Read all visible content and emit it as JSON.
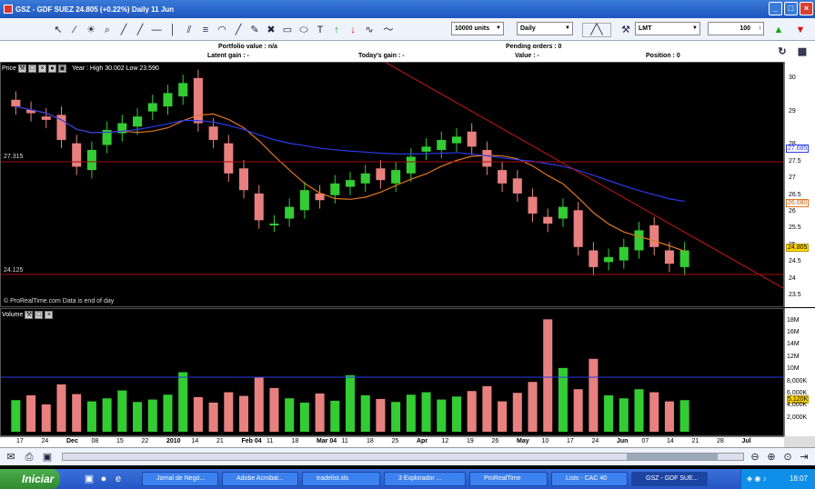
{
  "window": {
    "title": "GSZ - GDF SUEZ    24.805 (+0.22%)    Daily   11 Jun",
    "controls": [
      "_",
      "□",
      "×"
    ]
  },
  "toolbar": {
    "units": "10000 units",
    "interval": "Daily",
    "order_type": "LMT",
    "quantity": "100"
  },
  "info": {
    "portfolio_value": "Portfolio value : n/a",
    "latent_gain": "Latent gain : -",
    "todays_gain": "Today's gain : -",
    "pending_orders": "Pending orders : 0",
    "value": "Value : -",
    "position": "Position : 0"
  },
  "price_panel": {
    "label": "Price",
    "stats": "Year : High 30.002 Low 23.590",
    "copyright": "© ProRealTime.com  Data is end of day",
    "level_high_label": "27.315",
    "level_low_label": "24.125",
    "y_ticks": [
      "30",
      "29",
      "28",
      "27.5",
      "27",
      "26.5",
      "26",
      "25.5",
      "25",
      "24.5",
      "24",
      "23.5"
    ],
    "badges": {
      "ma_blue": "27.685",
      "ma_orange": "26.080",
      "last": "24.805"
    },
    "colors": {
      "up": "#33cc33",
      "down": "#e88080",
      "ma_blue": "#2a3ae8",
      "ma_orange": "#e07820",
      "trend": "#c81818",
      "level": "#a01010"
    }
  },
  "volume_panel": {
    "label": "Volume",
    "y_ticks": [
      "18M",
      "16M",
      "14M",
      "12M",
      "10M",
      "8,000K",
      "6,000K",
      "5,120K",
      "4,000K",
      "2,000K"
    ]
  },
  "x_axis": [
    "17",
    "24",
    "Dec",
    "08",
    "15",
    "22",
    "2010",
    "14",
    "21",
    "Feb 04",
    "11",
    "18",
    "Mar 04",
    "11",
    "18",
    "25",
    "Apr",
    "12",
    "19",
    "26",
    "May",
    "10",
    "17",
    "24",
    "Jun",
    "07",
    "14",
    "21",
    "28",
    "Jul"
  ],
  "taskbar": {
    "start": "Iniciar",
    "items": [
      "Jornal de Negó...",
      "Adobe Acrobat...",
      "tradelist.xls",
      "3 Explorador ...",
      "ProRealTime",
      "Lists - CAC 40",
      "GSZ - GDF SUE..."
    ],
    "clock": "18:07"
  },
  "chart_data": {
    "type": "candlestick",
    "title": "GSZ - GDF SUEZ",
    "series": [
      {
        "name": "Price close (approx.)",
        "values": [
          29.2,
          29.0,
          28.8,
          28.2,
          27.4,
          27.9,
          28.5,
          28.7,
          28.9,
          29.3,
          29.6,
          29.9,
          28.7,
          28.2,
          27.2,
          26.7,
          25.8,
          25.7,
          26.2,
          26.7,
          26.4,
          26.9,
          27.0,
          27.2,
          27.0,
          27.3,
          27.7,
          28.0,
          28.2,
          28.3,
          28.0,
          27.4,
          26.9,
          26.6,
          26.0,
          25.7,
          26.2,
          25.0,
          24.4,
          24.7,
          25.0,
          25.5,
          25.0,
          24.5,
          24.9
        ]
      },
      {
        "name": "Volume (M, approx.)",
        "values": [
          5.2,
          6.0,
          4.5,
          7.8,
          6.2,
          5.0,
          5.5,
          6.8,
          4.9,
          5.3,
          6.1,
          9.8,
          5.7,
          4.8,
          6.5,
          5.9,
          9.0,
          7.2,
          5.5,
          4.8,
          6.3,
          5.1,
          9.3,
          6.0,
          5.4,
          4.9,
          6.1,
          6.5,
          5.3,
          5.8,
          6.7,
          7.5,
          5.0,
          6.4,
          8.2,
          18.5,
          10.5,
          7.0,
          12.0,
          6.0,
          5.5,
          7.0,
          6.5,
          5.0,
          5.2
        ]
      }
    ],
    "ylim": [
      23.5,
      30.1
    ]
  }
}
